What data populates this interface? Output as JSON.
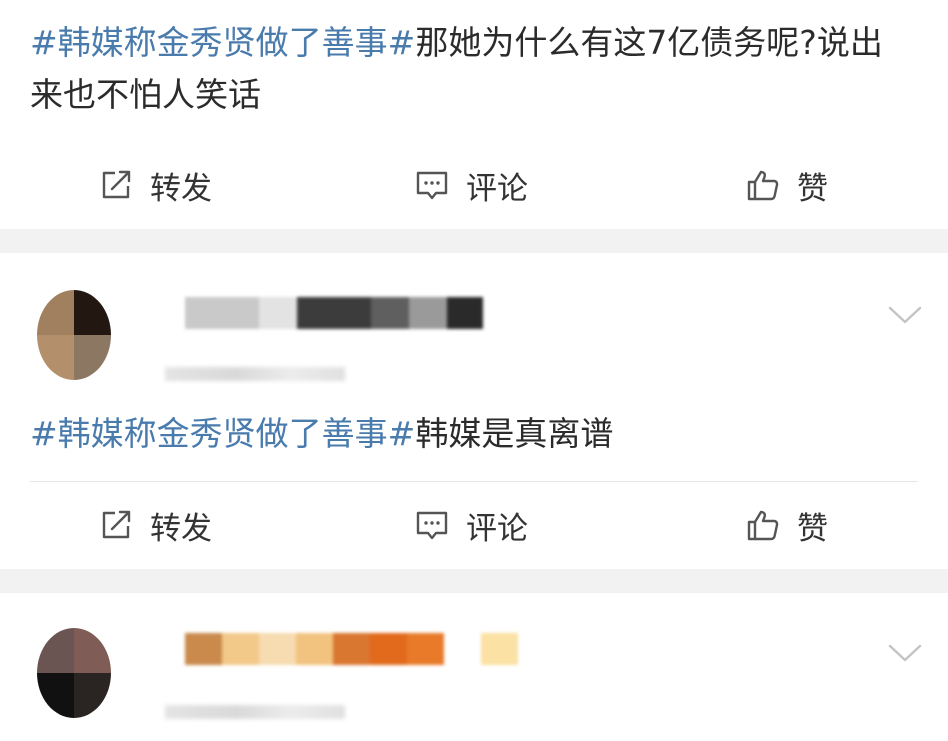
{
  "posts": [
    {
      "topic": "#韩媒称金秀贤做了善事#",
      "text": "那她为什么有这7亿债务呢?说出来也不怕人笑话",
      "actions": {
        "repost": "转发",
        "comment": "评论",
        "like": "赞"
      }
    },
    {
      "topic": "#韩媒称金秀贤做了善事#",
      "text": "韩媒是真离谱",
      "actions": {
        "repost": "转发",
        "comment": "评论",
        "like": "赞"
      }
    }
  ],
  "icons": {
    "repost": "repost-icon",
    "comment": "comment-icon",
    "like": "thumbs-up-icon",
    "menu": "chevron-down-icon"
  },
  "colors": {
    "topic": "#4a7bad",
    "text": "#2b2b2b",
    "page_background": "#f2f2f2"
  }
}
